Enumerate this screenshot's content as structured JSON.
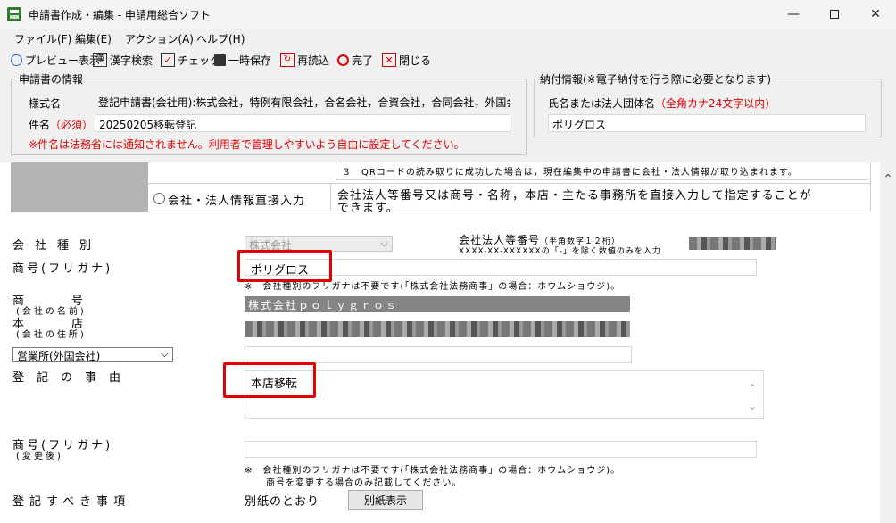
{
  "window": {
    "title": "申請書作成・編集 - 申請用総合ソフト",
    "minimize": "—",
    "close": "✕"
  },
  "menu": [
    "ファイル(F)",
    "編集(E)",
    "アクション(A)",
    "ヘルプ(H)"
  ],
  "toolbar": [
    {
      "label": "プレビュー表示",
      "icon": "preview-icon"
    },
    {
      "label": "漢字検索",
      "icon": "kanji-search-icon"
    },
    {
      "label": "チェック",
      "icon": "check-icon"
    },
    {
      "label": "一時保存",
      "icon": "save-icon"
    },
    {
      "label": "再読込",
      "icon": "reload-icon"
    },
    {
      "label": "完了",
      "icon": "complete-icon"
    },
    {
      "label": "閉じる",
      "icon": "close-icon"
    }
  ],
  "application_info": {
    "group_title": "申請書の情報",
    "form_name_label": "様式名",
    "form_name_value": "登記申請書(会社用):株式会社，特例有限会社，合名会社，合資会社，合同会社，外国会社",
    "subject_label": "件名",
    "subject_required": "（必須）",
    "subject_value": "20250205移転登記",
    "note": "※件名は法務省には通知されません。利用者で管理しやすいよう自由に設定してください。"
  },
  "payment_info": {
    "group_title": "納付情報(※電子納付を行う際に必要となります)",
    "name_label": "氏名または法人団体名",
    "name_hint": "（全角カナ24文字以内)",
    "name_value": "ポリグロス"
  },
  "main": {
    "qr_note": "３　QRコードの読み取りに成功した場合は，現在編集中の申請書に会社・法人情報が取り込まれます。",
    "direct_input_radio": "会社・法人情報直接入力",
    "direct_input_desc_1": "会社法人等番号又は商号・名称，本店・主たる事務所を直接入力して指定することが",
    "direct_input_desc_2": "できます。",
    "company_type_label": "会社種別",
    "company_type_value": "株式会社",
    "corp_number_label": "会社法人等番号",
    "corp_number_hint1": "（半角数字１２桁）",
    "corp_number_hint2": "XXXX-XX-XXXXXXの「-」を除く数値のみを入力",
    "trade_name_kana_label": "商号(フリガナ)",
    "trade_name_kana_value": "ポリグロス",
    "trade_name_kana_note": "※　会社種別のフリガナは不要です(「株式会社法務商事」の場合：ホウムショウジ)。",
    "trade_name_label": "商　号",
    "trade_name_sub": "(会社の名前)",
    "trade_name_value": "株式会社ｐｏｌｙｇｒｏｓ",
    "head_office_label": "本　店",
    "head_office_sub": "(会社の住所)",
    "office_select_value": "営業所(外国会社)",
    "reg_matter_label": "登記の事由",
    "reg_matter_value": "本店移転",
    "trade_name_kana_after_label": "商号(フリガナ)",
    "trade_name_kana_after_sub": "(変更後)",
    "after_note_1": "※　会社種別のフリガナは不要です(「株式会社法務商事」の場合：ホウムショウジ)。",
    "after_note_2": "商号を変更する場合のみ記載してください。",
    "reg_items_label": "登記すべき事項",
    "reg_items_value": "別紙のとおり",
    "attachment_button": "別紙表示"
  },
  "colors": {
    "required": "#e00000",
    "highlight": "#e00000"
  }
}
